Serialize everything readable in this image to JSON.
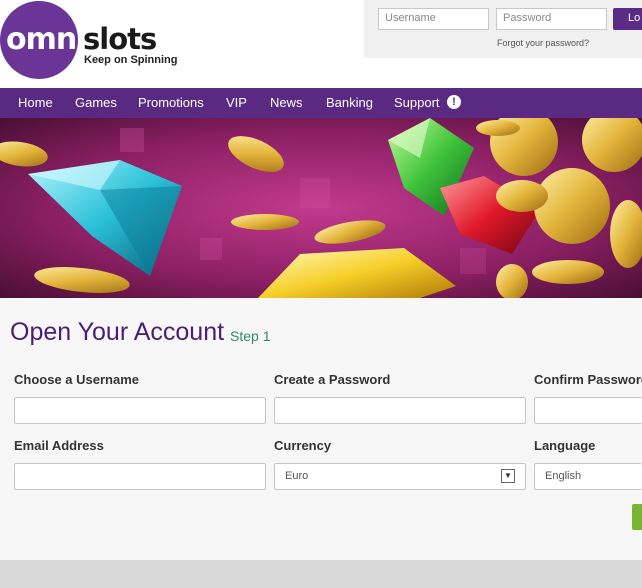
{
  "brand": {
    "name_part1": "omni",
    "name_part2": "slots",
    "tagline": "Keep on Spinning"
  },
  "login": {
    "username_placeholder": "Username",
    "password_placeholder": "Password",
    "button_label": "Lo",
    "forgot_label": "Forgot your password?"
  },
  "nav": {
    "items": [
      "Home",
      "Games",
      "Promotions",
      "VIP",
      "News",
      "Banking",
      "Support"
    ],
    "support_icon": "!"
  },
  "form": {
    "title": "Open Your Account",
    "step": "Step 1",
    "username_label": "Choose a Username",
    "password_label": "Create a Password",
    "confirm_label": "Confirm Password",
    "email_label": "Email Address",
    "currency_label": "Currency",
    "language_label": "Language",
    "currency_value": "Euro",
    "language_value": "English"
  },
  "colors": {
    "brand_purple": "#5a2a82",
    "logo_purple": "#6a3596",
    "step_green": "#2e8b6b",
    "submit_green": "#7ab532"
  }
}
